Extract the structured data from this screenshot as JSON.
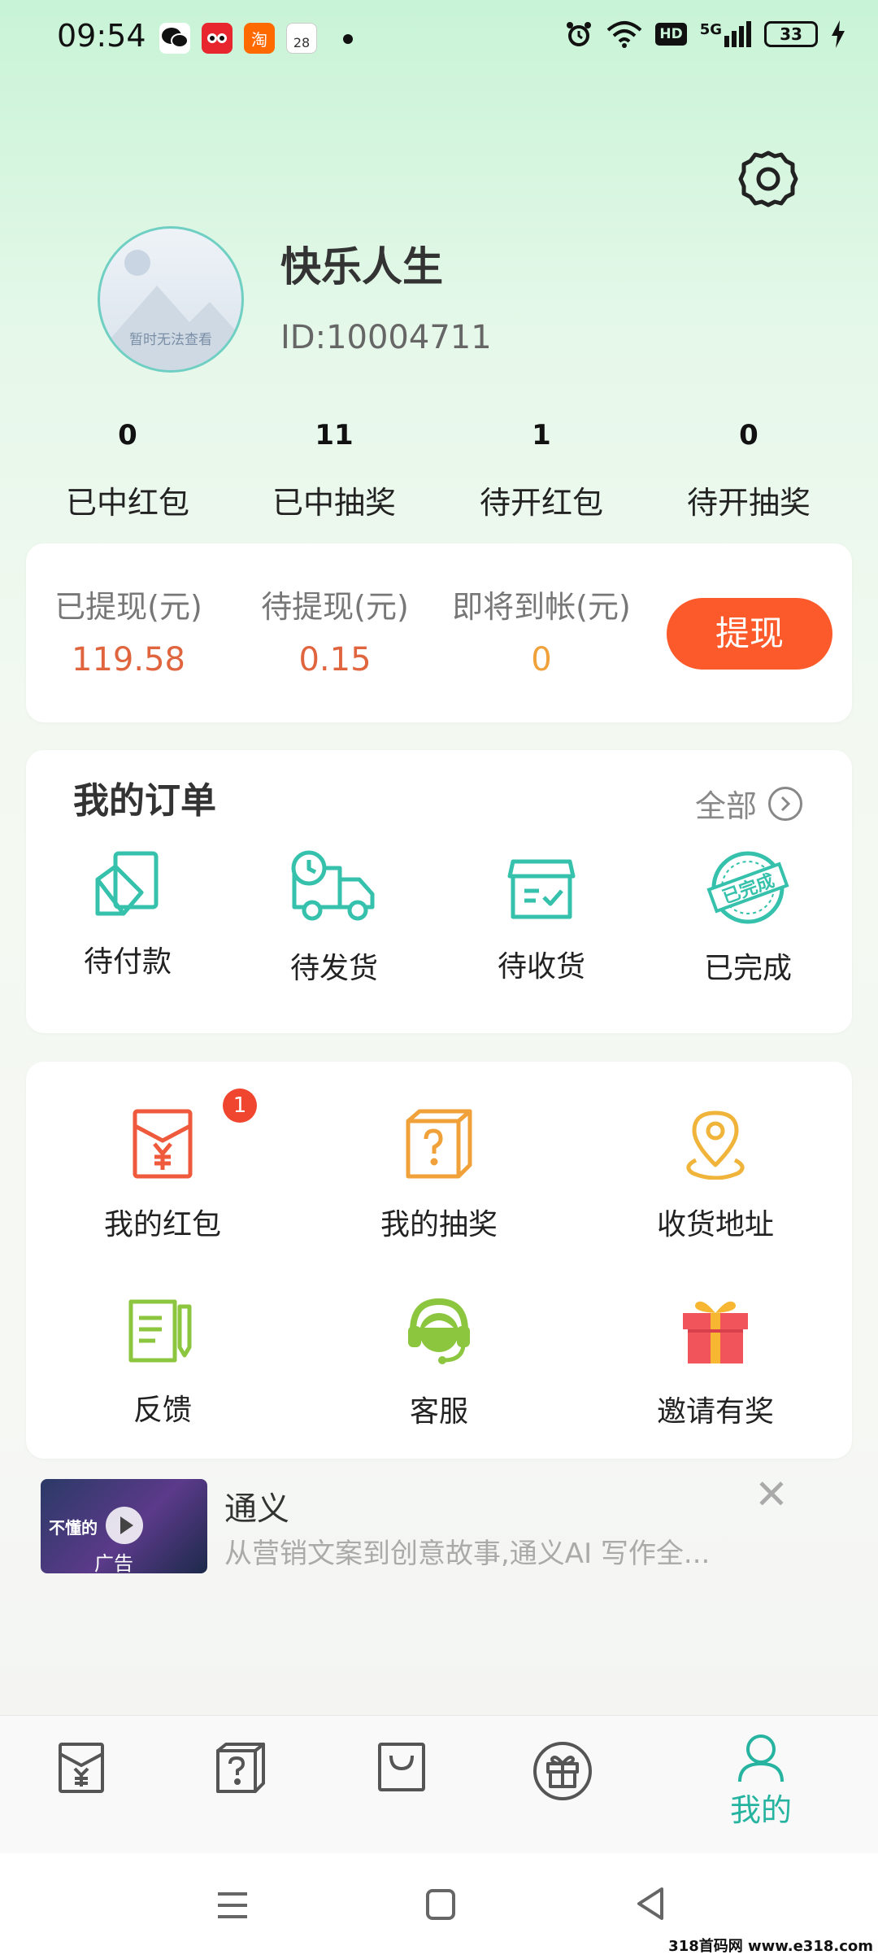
{
  "status_bar": {
    "time": "09:54",
    "notification_icons": [
      "wechat-icon",
      "tmall-icon",
      "taobao-icon",
      "calendar-icon"
    ],
    "taobao_label": "淘",
    "calendar_day": "28",
    "network": "5G",
    "hd_label": "HD",
    "battery": "33"
  },
  "profile": {
    "name": "快乐人生",
    "id_text": "ID:10004711",
    "avatar_caption": "暂时无法查看"
  },
  "stats": [
    {
      "value": "0",
      "label": "已中红包"
    },
    {
      "value": "11",
      "label": "已中抽奖"
    },
    {
      "value": "1",
      "label": "待开红包"
    },
    {
      "value": "0",
      "label": "待开抽奖"
    }
  ],
  "wallet": {
    "items": [
      {
        "label": "已提现(元)",
        "value": "119.58",
        "color": "#e0653f"
      },
      {
        "label": "待提现(元)",
        "value": "0.15",
        "color": "#e0653f"
      },
      {
        "label": "即将到帐(元)",
        "value": "0",
        "color": "#f0a13a"
      }
    ],
    "withdraw_label": "提现",
    "button_color": "#fc5a2a"
  },
  "orders": {
    "title": "我的订单",
    "all_label": "全部",
    "items": [
      {
        "label": "待付款",
        "icon": "card-icon"
      },
      {
        "label": "待发货",
        "icon": "truck-icon"
      },
      {
        "label": "待收货",
        "icon": "box-icon"
      },
      {
        "label": "已完成",
        "icon": "completed-stamp-icon",
        "stamp_text": "已完成"
      }
    ],
    "accent": "#35c1ab"
  },
  "tools": {
    "badge": "1",
    "items": [
      {
        "label": "我的红包",
        "icon": "red-packet-icon"
      },
      {
        "label": "我的抽奖",
        "icon": "mystery-box-icon"
      },
      {
        "label": "收货地址",
        "icon": "location-icon"
      },
      {
        "label": "反馈",
        "icon": "feedback-icon"
      },
      {
        "label": "客服",
        "icon": "customer-service-icon"
      },
      {
        "label": "邀请有奖",
        "icon": "gift-icon"
      }
    ]
  },
  "ad": {
    "title": "通义",
    "description": "从营销文案到创意故事,通义AI 写作全...",
    "thumb_text": "不懂的",
    "tag": "广告"
  },
  "tab_bar": {
    "tabs": [
      {
        "icon": "red-packet-tab-icon"
      },
      {
        "icon": "lottery-tab-icon"
      },
      {
        "icon": "shop-bag-tab-icon"
      },
      {
        "icon": "gift-tab-icon"
      },
      {
        "icon": "profile-tab-icon",
        "label": "我的",
        "active": true
      }
    ],
    "active_color": "#26b39f"
  },
  "watermark": "318首码网 www.e318.com"
}
